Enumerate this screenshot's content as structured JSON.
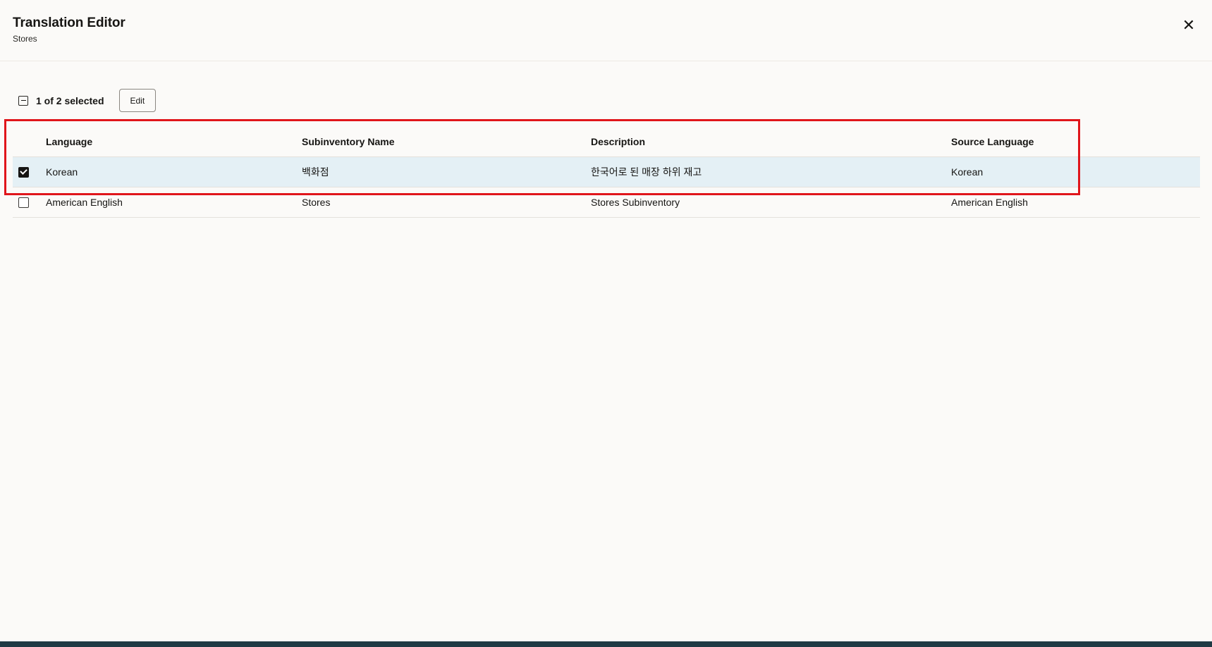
{
  "header": {
    "title": "Translation Editor",
    "subtitle": "Stores",
    "close_icon": "close-icon"
  },
  "toolbar": {
    "selection_text": "1 of 2 selected",
    "edit_label": "Edit"
  },
  "table": {
    "columns": [
      "Language",
      "Subinventory Name",
      "Description",
      "Source Language"
    ],
    "rows": [
      {
        "selected": true,
        "language": "Korean",
        "subinventory_name": "백화점",
        "description": "한국어로 된 매장 하위 재고",
        "source_language": "Korean"
      },
      {
        "selected": false,
        "language": "American English",
        "subinventory_name": "Stores",
        "description": "Stores Subinventory",
        "source_language": "American English"
      }
    ]
  },
  "colors": {
    "highlight": "#e0151b",
    "selected_row": "#e4f0f5",
    "background": "#fbfaf8"
  }
}
